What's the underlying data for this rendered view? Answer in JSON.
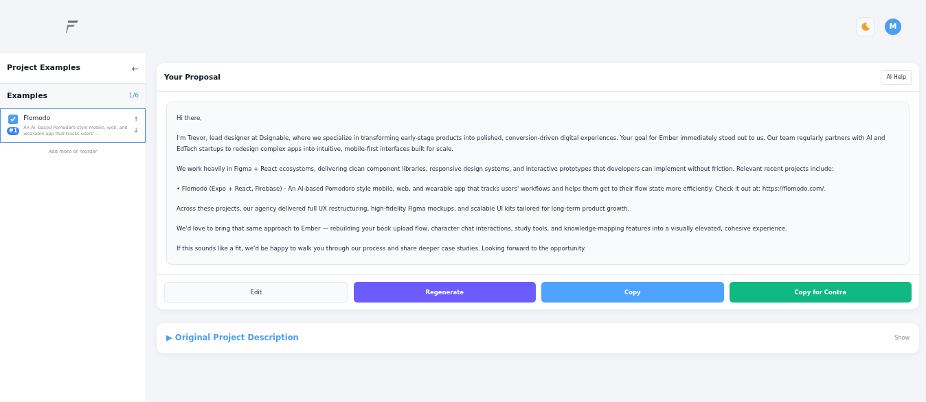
{
  "header": {
    "avatar": "M"
  },
  "sidebar": {
    "title": "Project Examples",
    "back": "←",
    "section": "Examples",
    "count": "1/6",
    "items": [
      {
        "title": "Flomodo",
        "badge": "#1",
        "description": "An AI -based Pomodoro style mobile, web, and wearable app that tracks users' ...",
        "checked": true,
        "selected": true,
        "up": "↑",
        "down": "↓"
      }
    ],
    "footer": "Add more or reorder"
  },
  "proposal": {
    "title": "Your Proposal",
    "help": "AI Help",
    "paragraphs": [
      "Hi there,",
      "I'm Trevor, lead designer at Dsignable, where we specialize in transforming early-stage products into polished, conversion-driven digital experiences. Your goal for Ember immediately stood out to us. Our team regularly partners with AI and EdTech startups to redesign complex apps into intuitive, mobile-first interfaces built for scale.",
      "We work heavily in Figma + React ecosystems, delivering clean component libraries, responsive design systems, and interactive prototypes that developers can implement without friction. Relevant recent projects include:",
      "• Flomodo (Expo + React, Firebase) - An AI-based Pomodoro style mobile, web, and wearable app that tracks users' workflows and helps them get to their flow state more efficiently. Check it out at: https://flomodo.com/.",
      "Across these projects, our agency delivered full UX restructuring, high-fidelity Figma mockups, and scalable UI kits tailored for long-term product growth.",
      "We'd love to bring that same approach to Ember — rebuilding your book upload flow, character chat interactions, study tools, and knowledge-mapping features into a visually elevated, cohesive experience.",
      "If this sounds like a fit, we'd be happy to walk you through our process and share deeper case studies. Looking forward to the opportunity."
    ],
    "buttons": [
      {
        "label": "Edit",
        "kind": "plain"
      },
      {
        "label": "Regenerate",
        "kind": "purple"
      },
      {
        "label": "Copy",
        "kind": "blue"
      },
      {
        "label": "Copy for Contra",
        "kind": "green"
      }
    ]
  },
  "original": {
    "marker": "▶",
    "title": "Original Project Description",
    "toggle": "Show",
    "expanded": false
  }
}
